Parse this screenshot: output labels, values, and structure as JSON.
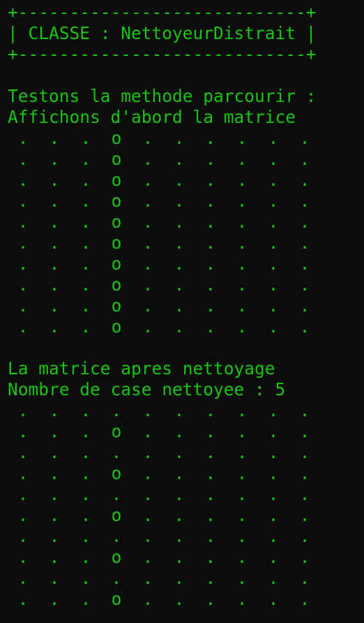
{
  "terminal": {
    "header": {
      "border_top": "+----------------------------+",
      "title": "| CLASSE : NettoyeurDistrait |",
      "border_bottom": "+----------------------------+"
    },
    "intro_line_1": "Testons la methode parcourir :",
    "intro_line_2": "Affichons d'abord la matrice",
    "after_line_1": "La matrice apres nettoyage",
    "after_line_2": "Nombre de case nettoyee : 5",
    "matrix_before": [
      [
        ".",
        ".",
        ".",
        "o",
        ".",
        ".",
        ".",
        ".",
        ".",
        "."
      ],
      [
        ".",
        ".",
        ".",
        "o",
        ".",
        ".",
        ".",
        ".",
        ".",
        "."
      ],
      [
        ".",
        ".",
        ".",
        "o",
        ".",
        ".",
        ".",
        ".",
        ".",
        "."
      ],
      [
        ".",
        ".",
        ".",
        "o",
        ".",
        ".",
        ".",
        ".",
        ".",
        "."
      ],
      [
        ".",
        ".",
        ".",
        "o",
        ".",
        ".",
        ".",
        ".",
        ".",
        "."
      ],
      [
        ".",
        ".",
        ".",
        "o",
        ".",
        ".",
        ".",
        ".",
        ".",
        "."
      ],
      [
        ".",
        ".",
        ".",
        "o",
        ".",
        ".",
        ".",
        ".",
        ".",
        "."
      ],
      [
        ".",
        ".",
        ".",
        "o",
        ".",
        ".",
        ".",
        ".",
        ".",
        "."
      ],
      [
        ".",
        ".",
        ".",
        "o",
        ".",
        ".",
        ".",
        ".",
        ".",
        "."
      ],
      [
        ".",
        ".",
        ".",
        "o",
        ".",
        ".",
        ".",
        ".",
        ".",
        "."
      ]
    ],
    "matrix_after": [
      [
        ".",
        ".",
        ".",
        ".",
        ".",
        ".",
        ".",
        ".",
        ".",
        "."
      ],
      [
        ".",
        ".",
        ".",
        "o",
        ".",
        ".",
        ".",
        ".",
        ".",
        "."
      ],
      [
        ".",
        ".",
        ".",
        ".",
        ".",
        ".",
        ".",
        ".",
        ".",
        "."
      ],
      [
        ".",
        ".",
        ".",
        "o",
        ".",
        ".",
        ".",
        ".",
        ".",
        "."
      ],
      [
        ".",
        ".",
        ".",
        ".",
        ".",
        ".",
        ".",
        ".",
        ".",
        "."
      ],
      [
        ".",
        ".",
        ".",
        "o",
        ".",
        ".",
        ".",
        ".",
        ".",
        "."
      ],
      [
        ".",
        ".",
        ".",
        ".",
        ".",
        ".",
        ".",
        ".",
        ".",
        "."
      ],
      [
        ".",
        ".",
        ".",
        "o",
        ".",
        ".",
        ".",
        ".",
        ".",
        "."
      ],
      [
        ".",
        ".",
        ".",
        ".",
        ".",
        ".",
        ".",
        ".",
        ".",
        "."
      ],
      [
        ".",
        ".",
        ".",
        "o",
        ".",
        ".",
        ".",
        ".",
        ".",
        "."
      ]
    ]
  }
}
